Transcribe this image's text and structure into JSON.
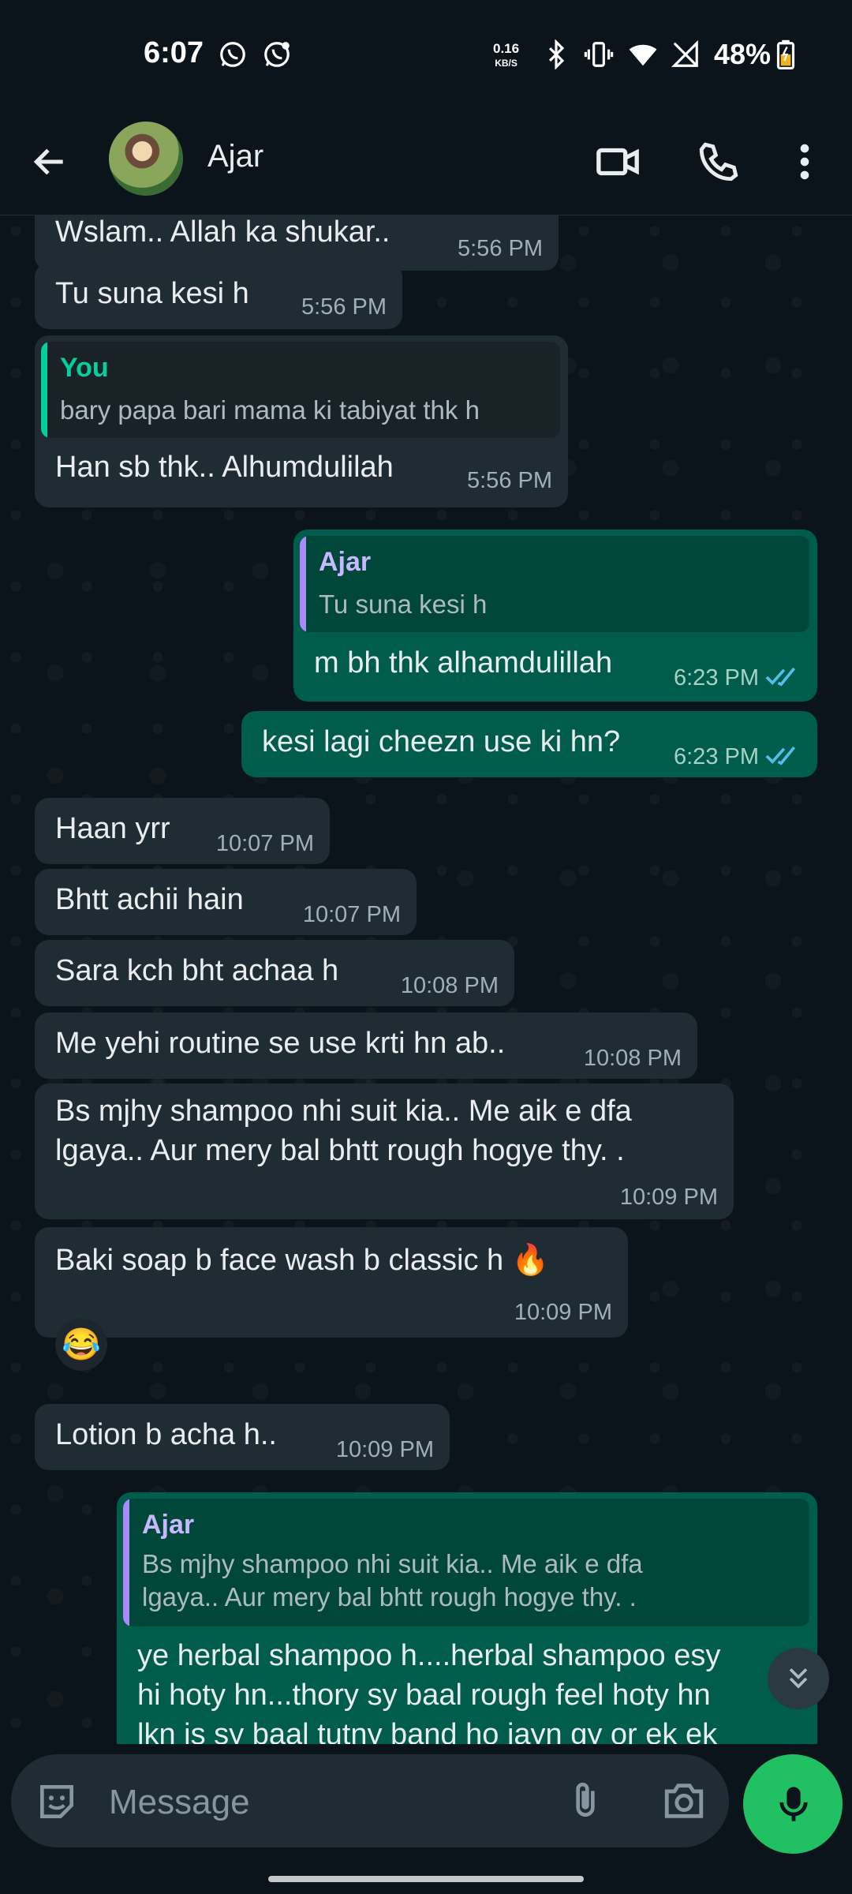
{
  "status_bar": {
    "time": "6:07",
    "net_speed_top": "0.16",
    "net_speed_bottom": "KB/S",
    "battery": "48%",
    "icons": [
      "whatsapp-icon",
      "whatsapp-business-icon",
      "bluetooth-icon",
      "vibrate-icon",
      "wifi-icon",
      "no-signal-icon",
      "battery-charging-icon"
    ]
  },
  "header": {
    "contact_name": "Ajar",
    "icons": [
      "back-arrow-icon",
      "video-call-icon",
      "voice-call-icon",
      "more-options-icon"
    ]
  },
  "messages": [
    {
      "dir": "in",
      "text": "Wslam.. Allah ka shukar..",
      "time": "5:56 PM"
    },
    {
      "dir": "in",
      "text": "Tu suna kesi h",
      "time": "5:56 PM"
    },
    {
      "dir": "in",
      "quote_name": "You",
      "quote_text": "bary papa bari mama ki tabiyat thk h",
      "text": "Han sb thk.. Alhumdulilah",
      "time": "5:56 PM"
    },
    {
      "dir": "out",
      "quote_name": "Ajar",
      "quote_text": "Tu suna kesi h",
      "text": "m bh thk alhamdulillah",
      "time": "6:23 PM"
    },
    {
      "dir": "out",
      "text": "kesi lagi cheezn use ki hn?",
      "time": "6:23 PM"
    },
    {
      "dir": "in",
      "text": "Haan yrr",
      "time": "10:07 PM"
    },
    {
      "dir": "in",
      "text": "Bhtt achii hain",
      "time": "10:07 PM"
    },
    {
      "dir": "in",
      "text": "Sara kch bht achaa h",
      "time": "10:08 PM"
    },
    {
      "dir": "in",
      "text": "Me yehi routine se use krti hn ab..",
      "time": "10:08 PM"
    },
    {
      "dir": "in",
      "text_lines": [
        "Bs mjhy shampoo nhi suit kia.. Me aik e dfa",
        "lgaya.. Aur mery bal bhtt rough hogye thy. ."
      ],
      "time": "10:09 PM"
    },
    {
      "dir": "in",
      "text": "Baki soap b face wash b classic h 🔥",
      "time": "10:09 PM",
      "reaction": "😂"
    },
    {
      "dir": "in",
      "text": "Lotion b acha h..",
      "time": "10:09 PM"
    },
    {
      "dir": "out",
      "quote_name": "Ajar",
      "quote_lines": [
        "Bs mjhy shampoo nhi suit kia.. Me aik e dfa",
        "lgaya.. Aur mery bal bhtt rough hogye thy. ."
      ],
      "text_lines": [
        "ye herbal shampoo h....herbal shampoo esy",
        "hi hoty hn...thory sy baal rough feel hoty hn",
        "lkn is sy baal tutny band ho jayn gy or ek ek"
      ]
    }
  ],
  "composer": {
    "placeholder": "Message",
    "icons": [
      "sticker-icon",
      "attach-icon",
      "camera-icon",
      "mic-icon",
      "scroll-down-icon"
    ]
  },
  "colors": {
    "background": "#0b141a",
    "incoming_bubble": "#202c33",
    "outgoing_bubble": "#005c4b",
    "read_ticks": "#53bdeb",
    "mic_button": "#21c063",
    "quote_you": "#06cf9c",
    "quote_ajar": "#a78bfa"
  }
}
